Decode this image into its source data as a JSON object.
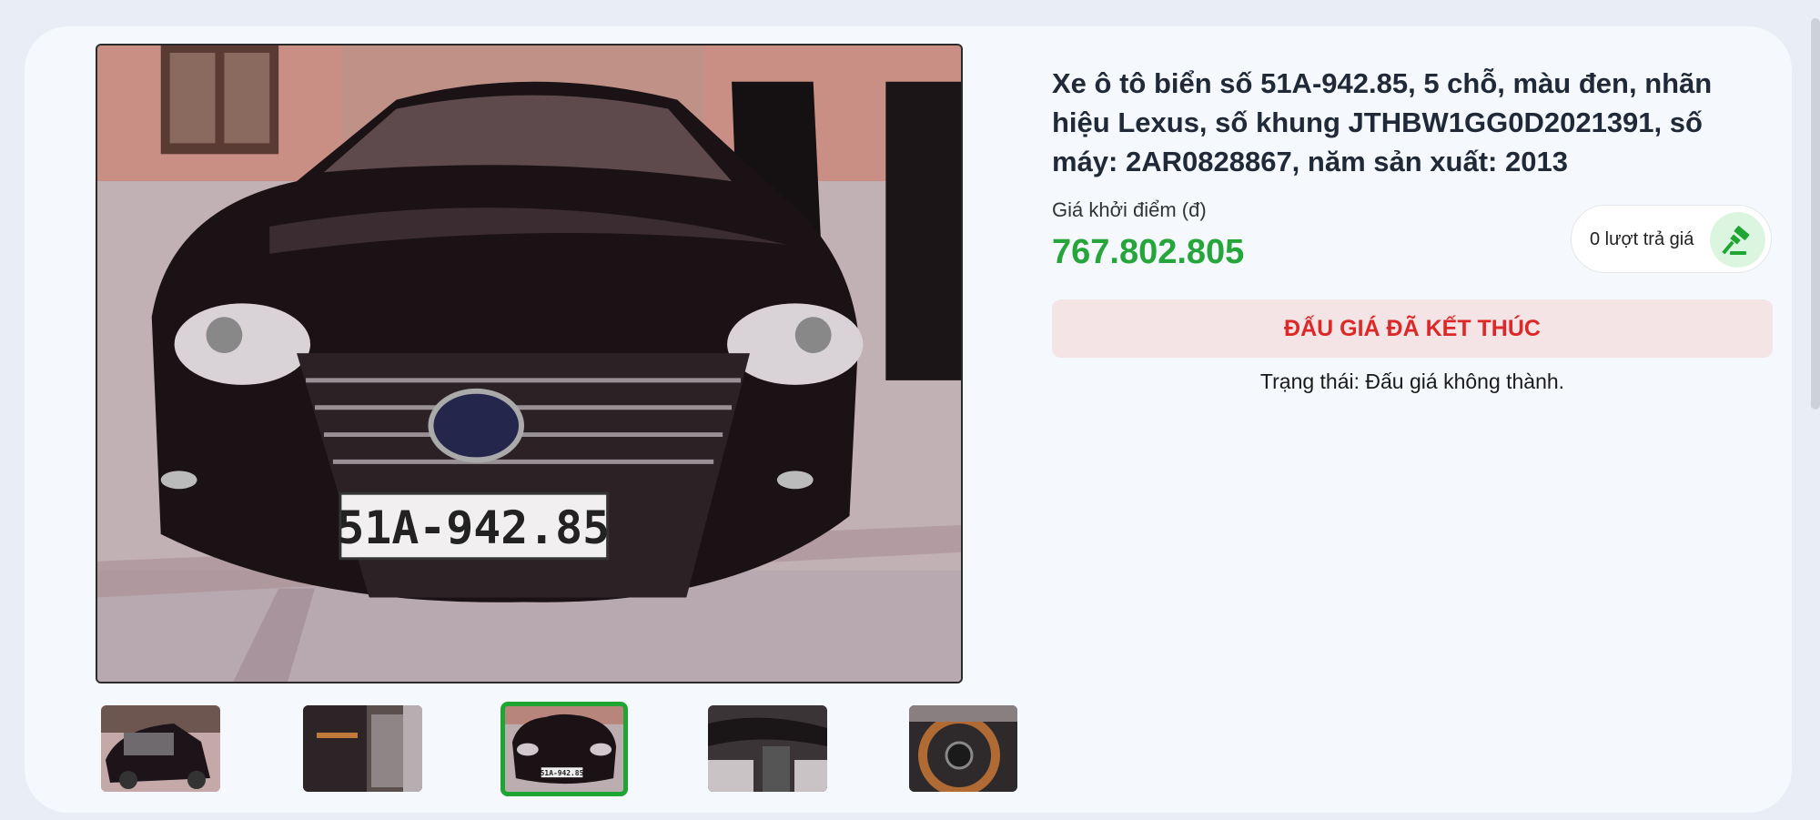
{
  "listing": {
    "title": "Xe ô tô biển số 51A-942.85, 5 chỗ, màu đen, nhãn hiệu Lexus, số khung JTHBW1GG0D2021391, số máy: 2AR0828867, năm sản xuất: 2013",
    "price_label": "Giá khởi điểm (đ)",
    "price_value": "767.802.805",
    "bid_count": "0 lượt trả giá",
    "status_banner": "ĐẤU GIÁ ĐÃ KẾT THÚC",
    "status_text": "Trạng thái: Đấu giá không thành.",
    "plate_text": "51A-942.85",
    "thumb_plate_text": "51A-942.85"
  },
  "gallery": {
    "active_index": 2,
    "thumbnails": [
      "engine-bay",
      "door-interior",
      "front-view",
      "dashboard",
      "steering-wheel"
    ]
  },
  "colors": {
    "accent_green": "#26a63a",
    "banner_bg": "#f5e4e5",
    "banner_text": "#dc2828"
  }
}
